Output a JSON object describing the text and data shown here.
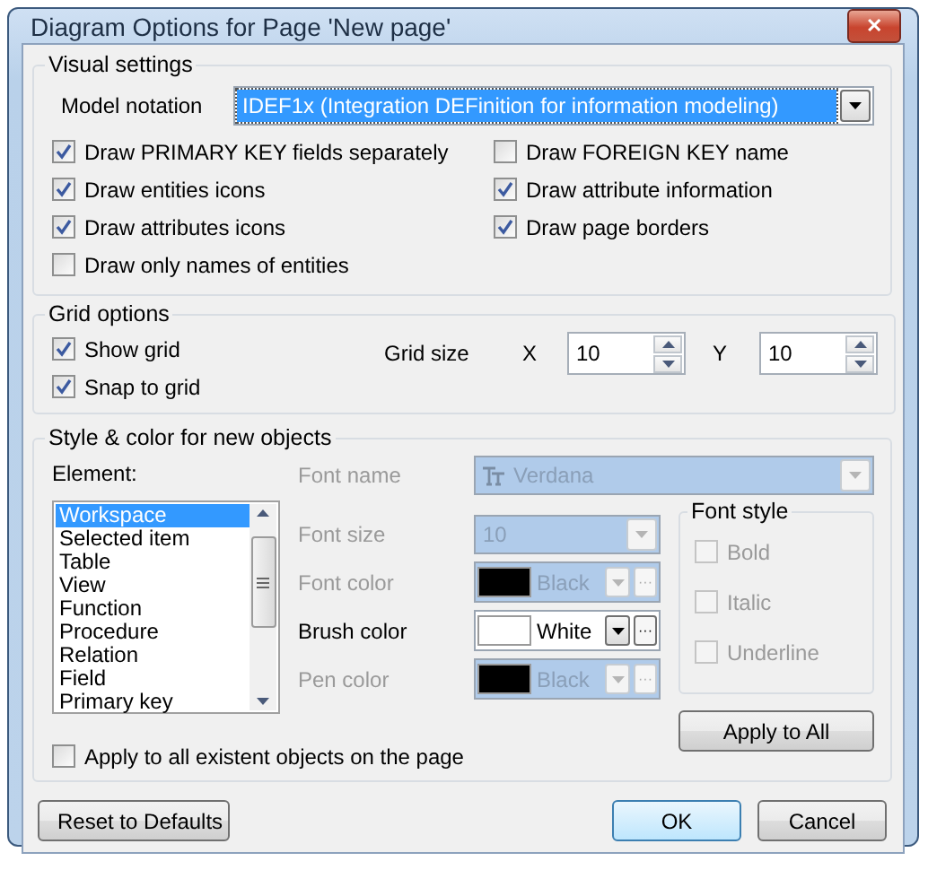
{
  "window": {
    "title": "Diagram Options for Page 'New page'",
    "close": "✕"
  },
  "visual_settings": {
    "title": "Visual settings",
    "model_notation": {
      "label": "Model notation",
      "value": "IDEF1x (Integration DEFinition for information modeling)"
    },
    "left_options": [
      {
        "label": "Draw PRIMARY KEY fields separately",
        "checked": true
      },
      {
        "label": "Draw entities icons",
        "checked": true
      },
      {
        "label": "Draw attributes icons",
        "checked": true
      },
      {
        "label": "Draw only names of entities",
        "checked": false
      }
    ],
    "right_options": [
      {
        "label": "Draw FOREIGN KEY name",
        "checked": false
      },
      {
        "label": "Draw attribute information",
        "checked": true
      },
      {
        "label": "Draw page borders",
        "checked": true
      }
    ]
  },
  "grid_options": {
    "title": "Grid options",
    "options": [
      {
        "label": "Show grid",
        "checked": true
      },
      {
        "label": "Snap to grid",
        "checked": true
      }
    ],
    "grid_size_label": "Grid size",
    "x": {
      "label": "X",
      "value": "10"
    },
    "y": {
      "label": "Y",
      "value": "10"
    }
  },
  "style": {
    "title": "Style & color for new objects",
    "element_label": "Element:",
    "elements": [
      {
        "label": "Workspace",
        "selected": true
      },
      {
        "label": "Selected item",
        "selected": false
      },
      {
        "label": "Table",
        "selected": false
      },
      {
        "label": "View",
        "selected": false
      },
      {
        "label": "Function",
        "selected": false
      },
      {
        "label": "Procedure",
        "selected": false
      },
      {
        "label": "Relation",
        "selected": false
      },
      {
        "label": "Field",
        "selected": false
      },
      {
        "label": "Primary key",
        "selected": false
      }
    ],
    "apply_existing": {
      "label": "Apply to all existent objects on the page",
      "checked": false
    },
    "font_name": {
      "label": "Font name",
      "value": "Verdana",
      "disabled": true
    },
    "font_size": {
      "label": "Font size",
      "value": "10",
      "disabled": true
    },
    "colors": [
      {
        "label": "Font color",
        "value": "Black",
        "color": "#000000",
        "disabled": true,
        "more": "···"
      },
      {
        "label": "Brush color",
        "value": "White",
        "color": "#ffffff",
        "disabled": false,
        "more": "···"
      },
      {
        "label": "Pen color",
        "value": "Black",
        "color": "#000000",
        "disabled": true,
        "more": "···"
      }
    ],
    "font_style": {
      "title": "Font style",
      "options": [
        {
          "label": "Bold",
          "checked": false,
          "disabled": true
        },
        {
          "label": "Italic",
          "checked": false,
          "disabled": true
        },
        {
          "label": "Underline",
          "checked": false,
          "disabled": true
        }
      ]
    },
    "apply_button": "Apply to All"
  },
  "buttons": [
    {
      "label": "Reset to Defaults",
      "kind": "reset"
    },
    {
      "label": "OK",
      "kind": "default"
    },
    {
      "label": "Cancel",
      "kind": "normal"
    }
  ]
}
